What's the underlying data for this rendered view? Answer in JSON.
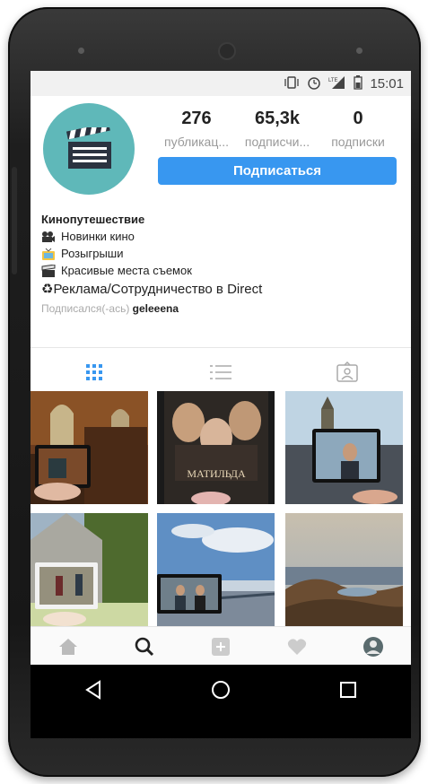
{
  "status": {
    "time": "15:01",
    "network": "LTE"
  },
  "profile": {
    "posts_count": "276",
    "posts_label": "публикац...",
    "followers_count": "65,3k",
    "followers_label": "подписчи...",
    "following_count": "0",
    "following_label": "подписки",
    "follow_button": "Подписаться"
  },
  "bio": {
    "name": "Кинопутешествие",
    "lines": [
      "Новинки кино",
      "Розыгрыши",
      "Красивые места съемок"
    ],
    "ad_line": "♻Реклама/Сотрудничество в Direct",
    "followed_by_prefix": "Подписался(-ась)",
    "followed_by_user": "geleeena"
  },
  "grid": {
    "poster_title": "МАТИЛЬДА"
  },
  "icons": {
    "tabs": [
      "grid-icon",
      "list-icon",
      "tagged-icon"
    ],
    "bottom_nav": [
      "home-icon",
      "search-icon",
      "add-icon",
      "heart-icon",
      "profile-avatar-icon"
    ],
    "system_nav": [
      "back-icon",
      "home-circle-icon",
      "recents-icon"
    ]
  },
  "colors": {
    "accent": "#3897f0",
    "avatar_bg": "#5fb8b9"
  }
}
